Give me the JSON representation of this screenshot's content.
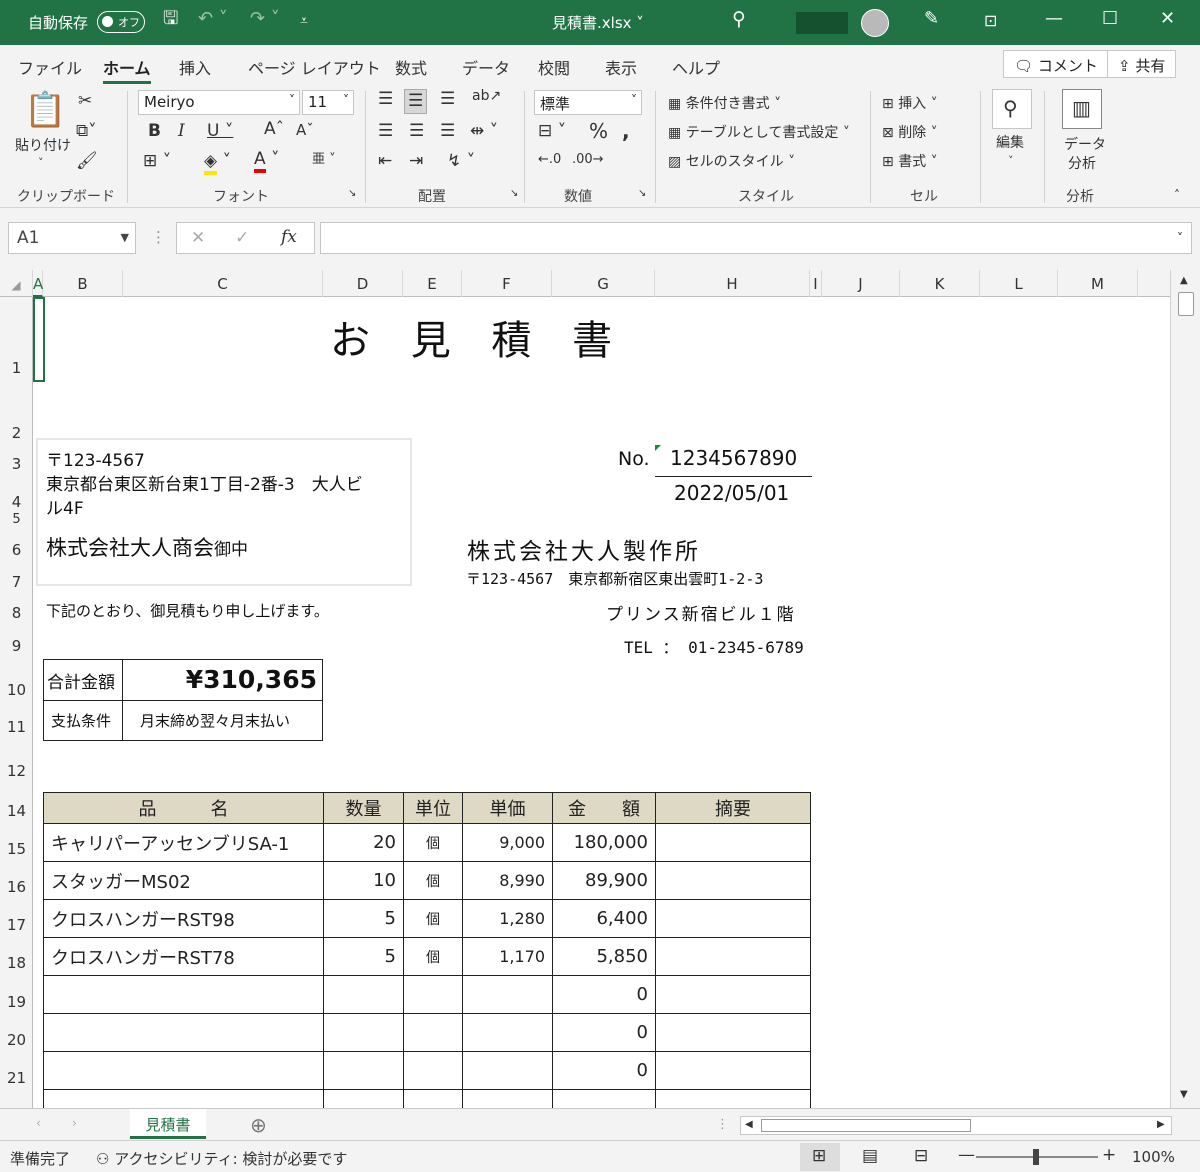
{
  "titlebar": {
    "autosave_label": "自動保存",
    "autosave_state": "オフ",
    "filename": "見積書.xlsx"
  },
  "tabs": [
    "ファイル",
    "ホーム",
    "挿入",
    "ページ レイアウト",
    "数式",
    "データ",
    "校閲",
    "表示",
    "ヘルプ"
  ],
  "tab_buttons": {
    "comment": "コメント",
    "share": "共有"
  },
  "ribbon": {
    "paste": "貼り付け",
    "font_name": "Meiryo",
    "font_size": "11",
    "number_format": "標準",
    "conditional": "条件付き書式",
    "format_table": "テーブルとして書式設定",
    "cell_style": "セルのスタイル",
    "insert": "挿入",
    "delete": "削除",
    "format": "書式",
    "edit": "編集",
    "data_analysis_1": "データ",
    "data_analysis_2": "分析",
    "groups": {
      "clipboard": "クリップボード",
      "font": "フォント",
      "alignment": "配置",
      "number": "数値",
      "style": "スタイル",
      "cells": "セル",
      "analysis": "分析"
    }
  },
  "formula_bar": {
    "name_box": "A1",
    "fx": "fx"
  },
  "columns": [
    "A",
    "B",
    "C",
    "D",
    "E",
    "F",
    "G",
    "H",
    "I",
    "J",
    "K",
    "L",
    "M"
  ],
  "rows": [
    "1",
    "2",
    "3",
    "4",
    "5",
    "6",
    "7",
    "8",
    "9",
    "10",
    "11",
    "12",
    "14",
    "15",
    "16",
    "17",
    "18",
    "19",
    "20",
    "21"
  ],
  "sheet": {
    "title": "お 見 積 書",
    "postal": "〒123-4567",
    "address_line1": "東京都台東区新台東1丁目-2番-3　大人ビ",
    "address_line2": "ル4F",
    "customer": "株式会社大人商会",
    "honorific": "御中",
    "no_label": "No.",
    "no_value": "1234567890",
    "date": "2022/05/01",
    "company": "株式会社大人製作所",
    "company_address": "〒123-4567　東京都新宿区東出雲町1-2-3",
    "company_building": "プリンス新宿ビル１階",
    "company_tel": "TEL ： 01-2345-6789",
    "intro": "下記のとおり、御見積もり申し上げます。",
    "total_label": "合計金額",
    "total_value": "¥310,365",
    "terms_label": "支払条件",
    "terms_value": "月末締め翌々月末払い",
    "table_headers": [
      "品　　　名",
      "数量",
      "単位",
      "単価",
      "金　　額",
      "摘要"
    ],
    "items": [
      {
        "name": "キャリパーアッセンブリSA-1",
        "qty": "20",
        "unit": "個",
        "price": "9,000",
        "amount": "180,000",
        "note": ""
      },
      {
        "name": "スタッガーMS02",
        "qty": "10",
        "unit": "個",
        "price": "8,990",
        "amount": "89,900",
        "note": ""
      },
      {
        "name": "クロスハンガーRST98",
        "qty": "5",
        "unit": "個",
        "price": "1,280",
        "amount": "6,400",
        "note": ""
      },
      {
        "name": "クロスハンガーRST78",
        "qty": "5",
        "unit": "個",
        "price": "1,170",
        "amount": "5,850",
        "note": ""
      },
      {
        "name": "",
        "qty": "",
        "unit": "",
        "price": "",
        "amount": "0",
        "note": ""
      },
      {
        "name": "",
        "qty": "",
        "unit": "",
        "price": "",
        "amount": "0",
        "note": ""
      },
      {
        "name": "",
        "qty": "",
        "unit": "",
        "price": "",
        "amount": "0",
        "note": ""
      }
    ]
  },
  "sheet_tab": "見積書",
  "status": {
    "ready": "準備完了",
    "accessibility": "アクセシビリティ: 検討が必要です",
    "zoom": "100%"
  },
  "colors": {
    "excel_green": "#217346",
    "header_fill": "#ddd9c4"
  }
}
